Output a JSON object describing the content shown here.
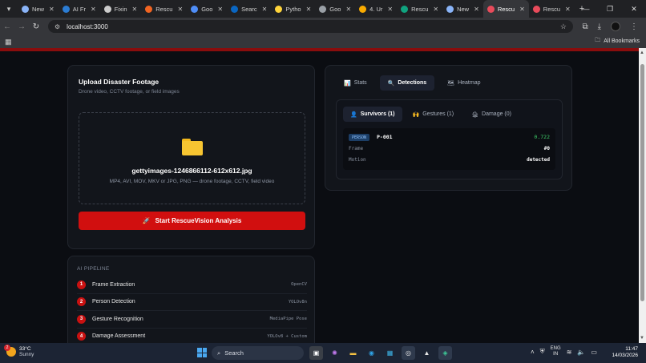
{
  "browser": {
    "tabs": [
      {
        "label": "New",
        "color": "#8ab4f8",
        "active": false
      },
      {
        "label": "AI Fr",
        "color": "#2b7cd3",
        "active": false
      },
      {
        "label": "Fixin",
        "color": "#cccccc",
        "active": false
      },
      {
        "label": "Rescu",
        "color": "#f26522",
        "active": false
      },
      {
        "label": "Goo",
        "color": "#4f8ef7",
        "active": false
      },
      {
        "label": "Searc",
        "color": "#0a66c2",
        "active": false
      },
      {
        "label": "Pytho",
        "color": "#ffd43b",
        "active": false
      },
      {
        "label": "Goo",
        "color": "#9aa0a6",
        "active": false
      },
      {
        "label": "4. Ur",
        "color": "#f9ab00",
        "active": false
      },
      {
        "label": "Rescu",
        "color": "#10a37f",
        "active": false
      },
      {
        "label": "New",
        "color": "#8ab4f8",
        "active": false
      },
      {
        "label": "Rescu",
        "color": "#e94b5b",
        "active": true
      },
      {
        "label": "Rescu",
        "color": "#e94b5b",
        "active": false
      }
    ],
    "new_tab_glyph": "+",
    "url": "localhost:3000",
    "all_bookmarks": "All Bookmarks"
  },
  "upload": {
    "title": "Upload Disaster Footage",
    "subtitle": "Drone video, CCTV footage, or field images",
    "file_name": "gettyimages-1246866112-612x612.jpg",
    "file_types": "MP4, AVI, MOV, MKV or JPG, PNG — drone footage, CCTV, field video",
    "analyze_button": "Start RescueVision Analysis",
    "accent": "#d10f0f"
  },
  "pipeline": {
    "title": "AI PIPELINE",
    "steps": [
      {
        "num": "1",
        "name": "Frame Extraction",
        "tool": "OpenCV"
      },
      {
        "num": "2",
        "name": "Person Detection",
        "tool": "YOLOv8n"
      },
      {
        "num": "3",
        "name": "Gesture Recognition",
        "tool": "MediaPipe Pose"
      },
      {
        "num": "4",
        "name": "Damage Assessment",
        "tool": "YOLOv8 + Custom"
      }
    ]
  },
  "results": {
    "main_tabs": [
      {
        "label": "Stats",
        "icon": "📊",
        "active": false
      },
      {
        "label": "Detections",
        "icon": "🔍",
        "active": true
      },
      {
        "label": "Heatmap",
        "icon": "🗺",
        "active": false
      }
    ],
    "sub_tabs": [
      {
        "label": "Survivors (1)",
        "icon": "👤",
        "active": true
      },
      {
        "label": "Gestures (1)",
        "icon": "🙌",
        "active": false
      },
      {
        "label": "Damage (0)",
        "icon": "🏚",
        "active": false
      }
    ],
    "detection": {
      "badge": "PERSON",
      "id": "P-001",
      "confidence": "0.722",
      "rows": [
        {
          "key": "Frame",
          "value": "#0"
        },
        {
          "key": "Motion",
          "value": "detected"
        }
      ]
    }
  },
  "taskbar": {
    "temperature": "33°C",
    "condition": "Sunny",
    "notification_count": "2",
    "search_placeholder": "Search",
    "language_top": "ENG",
    "language_bottom": "IN",
    "time": "11:47",
    "date": "14/03/2026"
  }
}
